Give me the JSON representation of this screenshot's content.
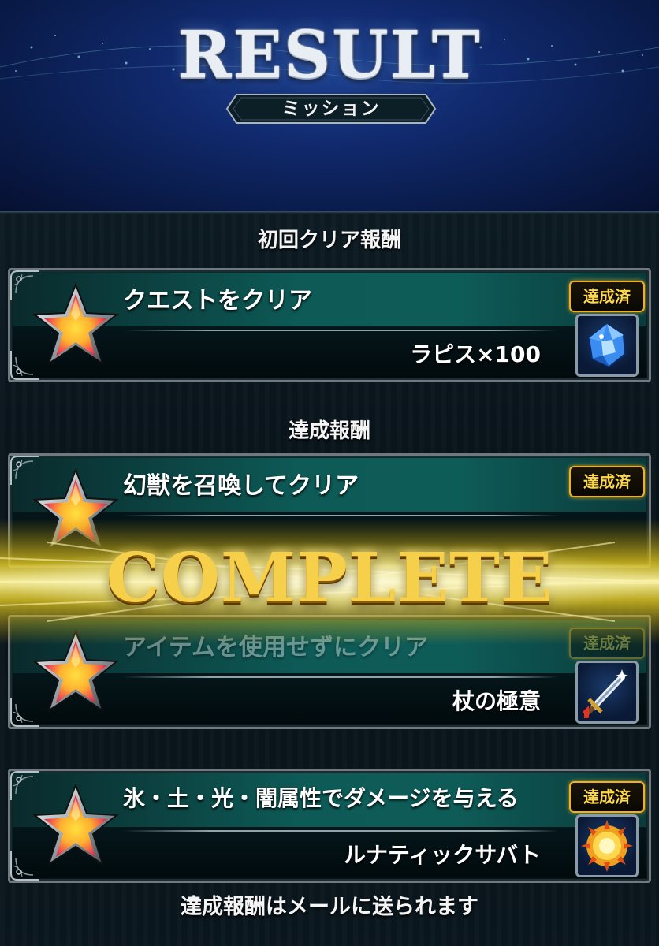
{
  "header": {
    "title": "RESULT",
    "subtitle": "ミッション"
  },
  "sections": {
    "first_clear_label": "初回クリア報酬",
    "achievement_label": "達成報酬"
  },
  "missions": [
    {
      "title": "クエストをクリア",
      "reward": "ラピス×100",
      "status": "達成済",
      "icon": "lapis-crystal-icon"
    },
    {
      "title": "幻獣を召喚してクリア",
      "reward": "",
      "status": "達成済",
      "icon": "esper-icon"
    },
    {
      "title": "アイテムを使用せずにクリア",
      "reward": "杖の極意",
      "status": "達成済",
      "icon": "sword-ability-icon"
    },
    {
      "title": "氷・土・光・闇属性でダメージを与える",
      "reward": "ルナティックサバト",
      "status": "達成済",
      "icon": "explosion-ability-icon"
    }
  ],
  "overlay": {
    "complete_text": "COMPLETE"
  },
  "footer": {
    "note": "達成報酬はメールに送られます"
  },
  "colors": {
    "badge_gold": "#f0b020",
    "complete_gold": "#f6d04a",
    "header_blue": "#112a6e",
    "card_teal": "#0d5a56"
  }
}
